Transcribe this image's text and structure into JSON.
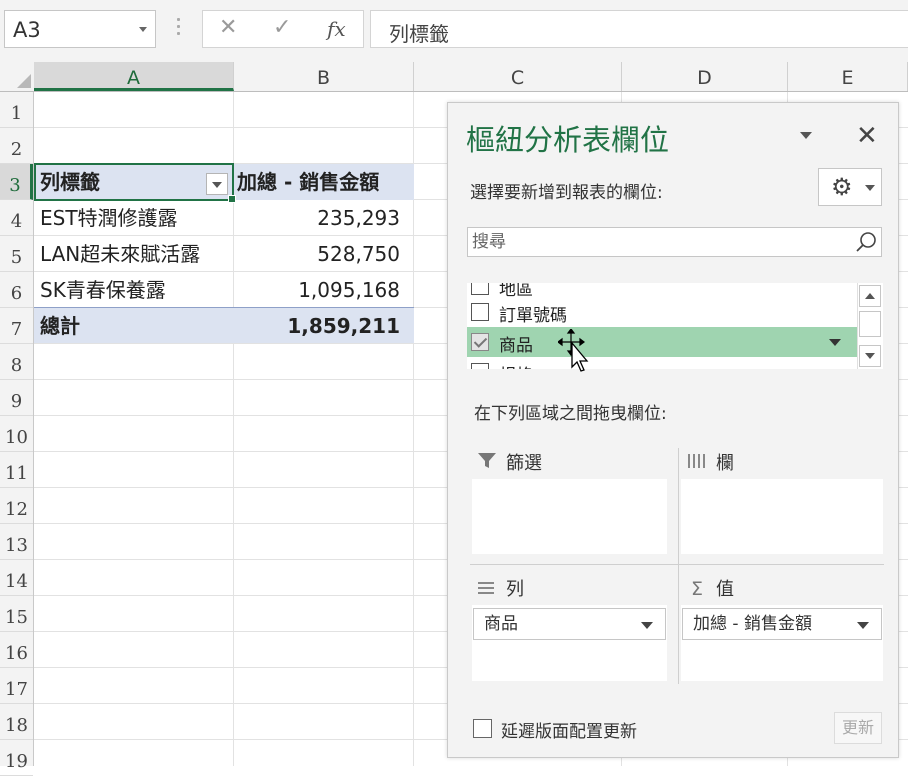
{
  "formula_bar": {
    "name_box": "A3",
    "cancel_glyph": "✕",
    "enter_glyph": "✓",
    "fx_label": "fx",
    "value": "列標籤"
  },
  "columns": [
    "A",
    "B",
    "C",
    "D",
    "E"
  ],
  "rows": [
    "1",
    "2",
    "3",
    "4",
    "5",
    "6",
    "7",
    "8",
    "9",
    "10",
    "11",
    "12",
    "13",
    "14",
    "15",
    "16",
    "17",
    "18",
    "19"
  ],
  "pivot": {
    "header_label": "列標籤",
    "header_value": "加總 - 銷售金額",
    "items": [
      {
        "label": "EST特潤修護露",
        "value": "235,293"
      },
      {
        "label": "LAN超未來賦活露",
        "value": "528,750"
      },
      {
        "label": "SK青春保養露",
        "value": "1,095,168"
      }
    ],
    "total_label": "總計",
    "total_value": "1,859,211"
  },
  "pane": {
    "title": "樞紐分析表欄位",
    "close_glyph": "✕",
    "choose_label": "選擇要新增到報表的欄位:",
    "search_placeholder": "搜尋",
    "fields": [
      {
        "name": "地區",
        "checked": false
      },
      {
        "name": "訂單號碼",
        "checked": false
      },
      {
        "name": "商品",
        "checked": true
      },
      {
        "name": "規格",
        "checked": false
      }
    ],
    "drag_label": "在下列區域之間拖曳欄位:",
    "areas": {
      "filter": {
        "label": "篩選",
        "icon": "filter-icon"
      },
      "columns": {
        "label": "欄",
        "icon": "columns-icon"
      },
      "rows": {
        "label": "列",
        "icon": "rows-icon",
        "chip": "商品"
      },
      "values": {
        "label": "值",
        "icon": "sigma-icon",
        "chip": "加總 - 銷售金額"
      }
    },
    "defer_label": "延遲版面配置更新",
    "update_label": "更新"
  },
  "colors": {
    "accent": "#217346",
    "pivot_header": "#dce3f1",
    "highlight": "#9fd4b0"
  }
}
